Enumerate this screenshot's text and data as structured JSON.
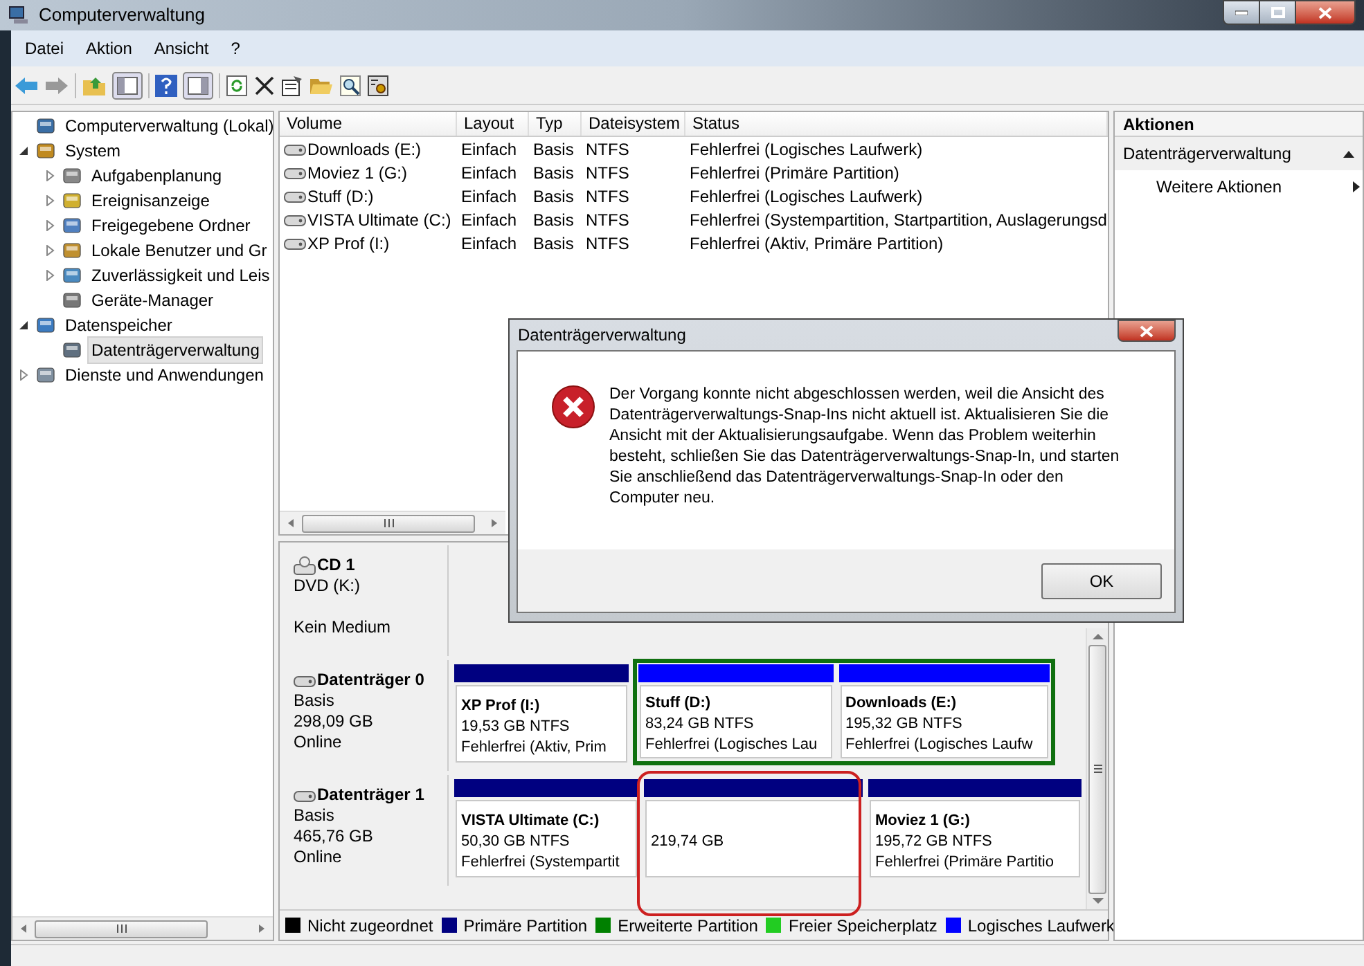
{
  "window": {
    "title": "Computerverwaltung"
  },
  "menu": [
    "Datei",
    "Aktion",
    "Ansicht",
    "?"
  ],
  "tree": [
    {
      "label": "Computerverwaltung (Lokal)",
      "selected": false,
      "children": [
        {
          "label": "System",
          "expanded": true,
          "selected": false,
          "children": [
            {
              "label": "Aufgabenplanung",
              "expanded": false,
              "selected": false
            },
            {
              "label": "Ereignisanzeige",
              "expanded": false,
              "selected": false
            },
            {
              "label": "Freigegebene Ordner",
              "expanded": false,
              "selected": false
            },
            {
              "label": "Lokale Benutzer und Gr",
              "expanded": false,
              "selected": false
            },
            {
              "label": "Zuverlässigkeit und Leis",
              "expanded": false,
              "selected": false
            },
            {
              "label": "Geräte-Manager",
              "selected": false
            }
          ]
        },
        {
          "label": "Datenspeicher",
          "expanded": true,
          "selected": false,
          "children": [
            {
              "label": "Datenträgerverwaltung",
              "selected": true
            }
          ]
        },
        {
          "label": "Dienste und Anwendungen",
          "expanded": false,
          "selected": false
        }
      ]
    }
  ],
  "volume_table": {
    "columns": [
      "Volume",
      "Layout",
      "Typ",
      "Dateisystem",
      "Status"
    ],
    "rows": [
      [
        "Downloads (E:)",
        "Einfach",
        "Basis",
        "NTFS",
        "Fehlerfrei (Logisches Laufwerk)"
      ],
      [
        "Moviez 1 (G:)",
        "Einfach",
        "Basis",
        "NTFS",
        "Fehlerfrei (Primäre Partition)"
      ],
      [
        "Stuff (D:)",
        "Einfach",
        "Basis",
        "NTFS",
        "Fehlerfrei (Logisches Laufwerk)"
      ],
      [
        "VISTA Ultimate (C:)",
        "Einfach",
        "Basis",
        "NTFS",
        "Fehlerfrei (Systempartition, Startpartition, Auslagerungsd"
      ],
      [
        "XP Prof (I:)",
        "Einfach",
        "Basis",
        "NTFS",
        "Fehlerfrei (Aktiv, Primäre Partition)"
      ]
    ]
  },
  "disks": [
    {
      "kind": "cdrom",
      "name": "CD 1",
      "type": "DVD (K:)",
      "status": "Kein Medium"
    },
    {
      "kind": "disk",
      "name": "Datenträger 0",
      "type": "Basis",
      "size": "298,09 GB",
      "status": "Online",
      "partitions": [
        {
          "kind": "primary",
          "name": "XP Prof  (I:)",
          "size": "19,53 GB NTFS",
          "status": "Fehlerfrei (Aktiv, Prim",
          "highlighted": false
        },
        {
          "kind": "extended",
          "highlighted": false,
          "children": [
            {
              "kind": "logical",
              "name": "Stuff  (D:)",
              "size": "83,24 GB NTFS",
              "status": "Fehlerfrei (Logisches Lau",
              "highlighted": false
            },
            {
              "kind": "logical",
              "name": "Downloads  (E:)",
              "size": "195,32 GB NTFS",
              "status": "Fehlerfrei (Logisches Laufw",
              "highlighted": false
            }
          ]
        }
      ]
    },
    {
      "kind": "disk",
      "name": "Datenträger 1",
      "type": "Basis",
      "size": "465,76 GB",
      "status": "Online",
      "partitions": [
        {
          "kind": "primary",
          "name": "VISTA Ultimate  (C:)",
          "size": "50,30 GB NTFS",
          "status": "Fehlerfrei (Systempartit",
          "highlighted": false
        },
        {
          "kind": "primary",
          "size": "219,74 GB",
          "highlighted": true
        },
        {
          "kind": "primary",
          "name": "Moviez 1  (G:)",
          "size": "195,72 GB NTFS",
          "status": "Fehlerfrei (Primäre Partitio",
          "highlighted": false
        }
      ]
    }
  ],
  "legend": [
    {
      "label": "Nicht zugeordnet",
      "color": "#000000"
    },
    {
      "label": "Primäre Partition",
      "color": "#000080"
    },
    {
      "label": "Erweiterte Partition",
      "color": "#008000"
    },
    {
      "label": "Freier Speicherplatz",
      "color": "#22cc22"
    },
    {
      "label": "Logisches Laufwerk",
      "color": "#0000ff"
    }
  ],
  "actions": {
    "title": "Aktionen",
    "section": "Datenträgerverwaltung",
    "expanded": true,
    "items": [
      "Weitere Aktionen"
    ]
  },
  "dialog": {
    "title": "Datenträgerverwaltung",
    "message": "Der Vorgang konnte nicht abgeschlossen werden, weil die Ansicht des Datenträgerverwaltungs-Snap-Ins nicht aktuell ist. Aktualisieren Sie die Ansicht mit der Aktualisierungsaufgabe. Wenn das Problem weiterhin besteht, schließen Sie das Datenträgerverwaltungs-Snap-In, und starten Sie anschließend das Datenträgerverwaltungs-Snap-In oder den Computer neu.",
    "button": "OK"
  }
}
